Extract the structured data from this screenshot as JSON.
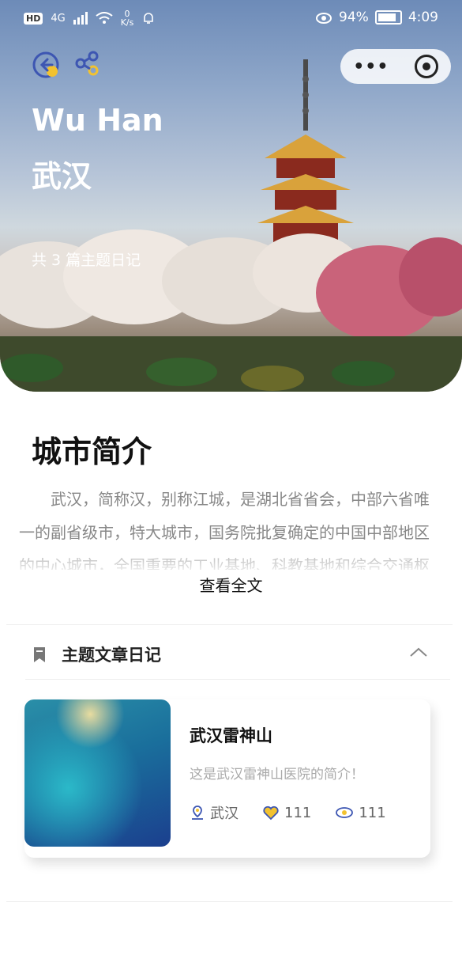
{
  "status_bar": {
    "network": "4G",
    "speed_value": "0",
    "speed_unit": "K/s",
    "battery": "94%",
    "time": "4:09"
  },
  "hero": {
    "title_en": "Wu Han",
    "title_cn": "武汉",
    "count_text": "共 3 篇主题日记"
  },
  "intro": {
    "heading": "城市简介",
    "text": "武汉，简称汉，别称江城，是湖北省省会，中部六省唯一的副省级市，特大城市，国务院批复确定的中国中部地区的中心城市，全国重要的工业基地、科教基地和综合交通枢纽。",
    "read_more": "查看全文"
  },
  "list": {
    "title": "主题文章日记",
    "items": [
      {
        "title": "武汉雷神山",
        "desc": "这是武汉雷神山医院的简介！",
        "location": "武汉",
        "likes": "111",
        "views": "111"
      }
    ]
  },
  "colors": {
    "accent_blue": "#3d56b2",
    "accent_yellow": "#f2c230"
  }
}
